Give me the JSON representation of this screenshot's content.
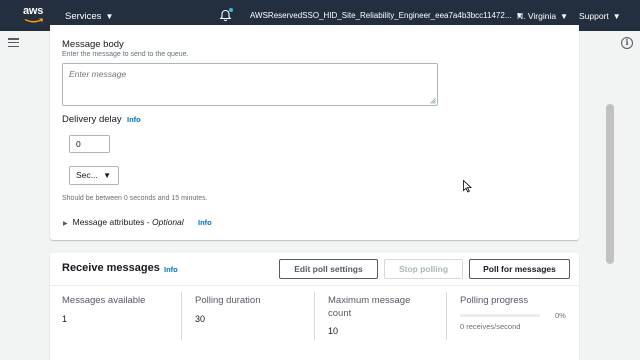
{
  "topbar": {
    "logo_text": "aws",
    "services_label": "Services",
    "role_label": "AWSReservedSSO_HID_Site_Reliability_Engineer_eea7a4b3bcc11472...",
    "region_label": "N. Virginia",
    "support_label": "Support",
    "caret": "▼",
    "icons": [
      "menu-icon",
      "bell-icon",
      "info-icon"
    ]
  },
  "send_panel": {
    "message_body_label": "Message body",
    "message_body_description": "Enter the message to send to the queue.",
    "message_body_placeholder": "Enter message",
    "delivery_delay_label": "Delivery delay",
    "info_label": "Info",
    "delay_value": "0",
    "delay_unit": "Sec...",
    "delay_hint": "Should be between 0 seconds and 15 minutes.",
    "attributes_label": "Message attributes - ",
    "attributes_optional": "Optional"
  },
  "receive_panel": {
    "title": "Receive messages",
    "info_label": "Info",
    "edit_poll_settings_label": "Edit poll settings",
    "stop_polling_label": "Stop polling",
    "poll_for_messages_label": "Poll for messages",
    "stats": {
      "messages_available_label": "Messages available",
      "messages_available_value": "1",
      "polling_duration_label": "Polling duration",
      "polling_duration_value": "30",
      "max_message_count_label_1": "Maximum message",
      "max_message_count_label_2": "count",
      "max_message_count_value": "10",
      "polling_progress_label": "Polling progress",
      "polling_progress_percent": "0%",
      "polling_progress_fraction": 0,
      "polling_progress_rate": "0 receives/second"
    }
  },
  "colors": {
    "nav_bg": "#232f3e",
    "accent": "#0073bb",
    "aws_orange": "#ff9900"
  }
}
